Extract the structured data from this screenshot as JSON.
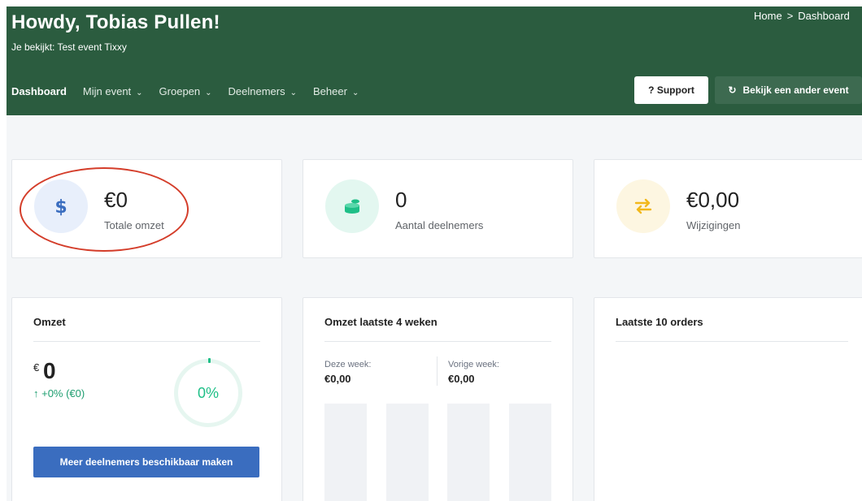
{
  "header": {
    "greeting": "Howdy, Tobias Pullen!",
    "viewing": "Je bekijkt: Test event Tixxy",
    "breadcrumb": {
      "home": "Home",
      "separator": ">",
      "current": "Dashboard"
    },
    "nav": [
      {
        "label": "Dashboard",
        "has_dropdown": false,
        "active": true
      },
      {
        "label": "Mijn event",
        "has_dropdown": true
      },
      {
        "label": "Groepen",
        "has_dropdown": true
      },
      {
        "label": "Deelnemers",
        "has_dropdown": true
      },
      {
        "label": "Beheer",
        "has_dropdown": true
      }
    ],
    "support_button": "? Support",
    "other_event_button": "Bekijk een ander event",
    "colors": {
      "header_bg": "#2b5c3f",
      "secondary_button_bg": "#3d6a50"
    }
  },
  "stats": [
    {
      "value": "€0",
      "label": "Totale omzet",
      "icon": "dollar-icon",
      "icon_color": "#3a6dbf",
      "icon_bg": "#e8effb",
      "highlighted": true
    },
    {
      "value": "0",
      "label": "Aantal deelnemers",
      "icon": "coins-icon",
      "icon_color": "#1ebf87",
      "icon_bg": "#e3f7f0"
    },
    {
      "value": "€0,00",
      "label": "Wijzigingen",
      "icon": "exchange-icon",
      "icon_color": "#f2b81b",
      "icon_bg": "#fdf6e1"
    }
  ],
  "omzet_panel": {
    "title": "Omzet",
    "currency_symbol": "€",
    "value": "0",
    "change": "↑ +0% (€0)",
    "progress_percent": 0,
    "progress_label": "0%",
    "button": "Meer deelnemers beschikbaar maken",
    "accent_color": "#1ebf87",
    "button_color": "#3a6dbf"
  },
  "weeks_panel": {
    "title": "Omzet laatste 4 weken",
    "this_week_label": "Deze week:",
    "this_week_value": "€0,00",
    "last_week_label": "Vorige week:",
    "last_week_value": "€0,00",
    "bars": [
      0,
      0,
      0,
      0
    ]
  },
  "orders_panel": {
    "title": "Laatste 10 orders"
  }
}
